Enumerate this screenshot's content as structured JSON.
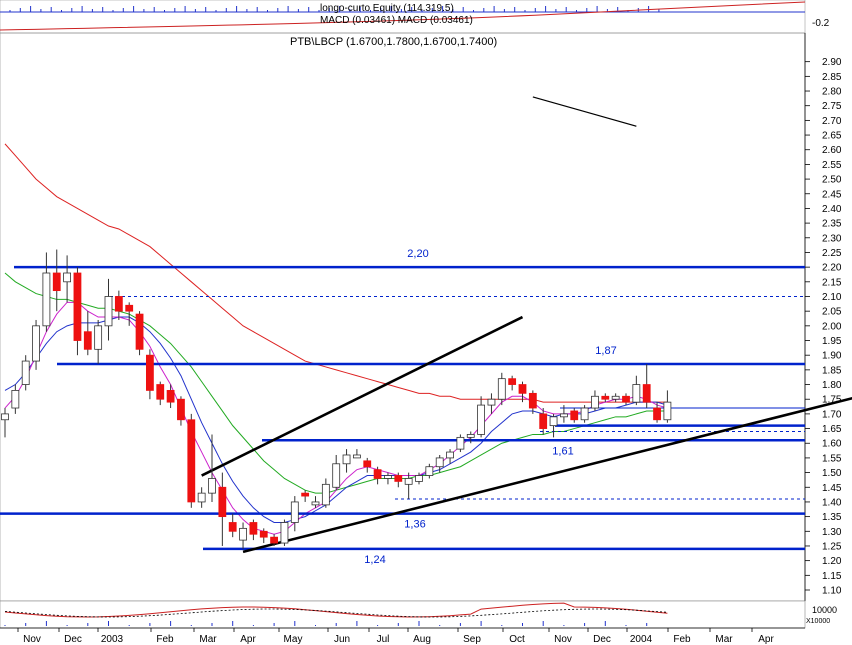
{
  "header": {
    "equity_label": "longo-curto Equity (114.319.5)",
    "macd_label": "MACD (0.03461) MACD (0.03461)",
    "macd_axis_tick": "-0.2"
  },
  "main_title": "PTB\\LBCP (1.6700,1.7800,1.6700,1.7400)",
  "bottom_axis_label": "10000",
  "bottom_axis_sub": "X10000",
  "colors": {
    "up": "#ffffff",
    "down": "#ee1111",
    "level": "#0022cc",
    "channel": "#000000",
    "ma_red": "#dd2222",
    "ma_green": "#22aa22",
    "ma_blue": "#2233cc",
    "ma_magenta": "#cc22cc"
  },
  "chart_data": {
    "type": "candlestick",
    "title": "PTB\\LBCP (1.6700,1.7800,1.6700,1.7400)",
    "ylim": [
      1.1,
      2.95
    ],
    "y_ticks": [
      "1.10",
      "1.15",
      "1.20",
      "1.25",
      "1.30",
      "1.35",
      "1.40",
      "1.45",
      "1.50",
      "1.55",
      "1.60",
      "1.65",
      "1.70",
      "1.75",
      "1.80",
      "1.85",
      "1.90",
      "1.95",
      "2.00",
      "2.05",
      "2.10",
      "2.15",
      "2.20",
      "2.25",
      "2.30",
      "2.35",
      "2.40",
      "2.45",
      "2.50",
      "2.55",
      "2.60",
      "2.65",
      "2.70",
      "2.75",
      "2.80",
      "2.85",
      "2.90"
    ],
    "x_ticks": [
      "Nov",
      "Dec",
      "2003",
      "Feb",
      "Mar",
      "Apr",
      "May",
      "Jun",
      "Jul",
      "Aug",
      "Sep",
      "Oct",
      "Nov",
      "Dec",
      "2004",
      "Feb",
      "Mar",
      "Apr"
    ],
    "candles": [
      {
        "o": 1.68,
        "h": 1.72,
        "l": 1.62,
        "c": 1.7
      },
      {
        "o": 1.72,
        "h": 1.8,
        "l": 1.7,
        "c": 1.78
      },
      {
        "o": 1.8,
        "h": 1.9,
        "l": 1.78,
        "c": 1.88
      },
      {
        "o": 1.88,
        "h": 2.02,
        "l": 1.85,
        "c": 2.0
      },
      {
        "o": 2.0,
        "h": 2.25,
        "l": 1.98,
        "c": 2.18
      },
      {
        "o": 2.18,
        "h": 2.26,
        "l": 2.05,
        "c": 2.12
      },
      {
        "o": 2.15,
        "h": 2.24,
        "l": 2.08,
        "c": 2.18
      },
      {
        "o": 2.18,
        "h": 2.2,
        "l": 1.9,
        "c": 1.95
      },
      {
        "o": 1.98,
        "h": 2.05,
        "l": 1.9,
        "c": 1.92
      },
      {
        "o": 1.92,
        "h": 2.02,
        "l": 1.87,
        "c": 2.0
      },
      {
        "o": 2.0,
        "h": 2.16,
        "l": 1.95,
        "c": 2.1
      },
      {
        "o": 2.1,
        "h": 2.12,
        "l": 2.02,
        "c": 2.05
      },
      {
        "o": 2.07,
        "h": 2.08,
        "l": 2.0,
        "c": 2.05
      },
      {
        "o": 2.04,
        "h": 2.05,
        "l": 1.9,
        "c": 1.92
      },
      {
        "o": 1.9,
        "h": 1.92,
        "l": 1.75,
        "c": 1.78
      },
      {
        "o": 1.8,
        "h": 1.81,
        "l": 1.73,
        "c": 1.75
      },
      {
        "o": 1.78,
        "h": 1.8,
        "l": 1.72,
        "c": 1.74
      },
      {
        "o": 1.75,
        "h": 1.76,
        "l": 1.66,
        "c": 1.68
      },
      {
        "o": 1.68,
        "h": 1.7,
        "l": 1.38,
        "c": 1.4
      },
      {
        "o": 1.4,
        "h": 1.45,
        "l": 1.38,
        "c": 1.43
      },
      {
        "o": 1.43,
        "h": 1.63,
        "l": 1.4,
        "c": 1.48
      },
      {
        "o": 1.45,
        "h": 1.5,
        "l": 1.25,
        "c": 1.35
      },
      {
        "o": 1.33,
        "h": 1.36,
        "l": 1.28,
        "c": 1.3
      },
      {
        "o": 1.27,
        "h": 1.33,
        "l": 1.24,
        "c": 1.31
      },
      {
        "o": 1.33,
        "h": 1.34,
        "l": 1.27,
        "c": 1.29
      },
      {
        "o": 1.3,
        "h": 1.31,
        "l": 1.26,
        "c": 1.28
      },
      {
        "o": 1.28,
        "h": 1.29,
        "l": 1.25,
        "c": 1.26
      },
      {
        "o": 1.26,
        "h": 1.34,
        "l": 1.25,
        "c": 1.33
      },
      {
        "o": 1.33,
        "h": 1.42,
        "l": 1.3,
        "c": 1.4
      },
      {
        "o": 1.43,
        "h": 1.44,
        "l": 1.4,
        "c": 1.42
      },
      {
        "o": 1.39,
        "h": 1.42,
        "l": 1.38,
        "c": 1.4
      },
      {
        "o": 1.39,
        "h": 1.48,
        "l": 1.38,
        "c": 1.46
      },
      {
        "o": 1.45,
        "h": 1.56,
        "l": 1.44,
        "c": 1.53
      },
      {
        "o": 1.53,
        "h": 1.58,
        "l": 1.5,
        "c": 1.56
      },
      {
        "o": 1.55,
        "h": 1.58,
        "l": 1.55,
        "c": 1.56
      },
      {
        "o": 1.54,
        "h": 1.55,
        "l": 1.5,
        "c": 1.52
      },
      {
        "o": 1.51,
        "h": 1.52,
        "l": 1.46,
        "c": 1.48
      },
      {
        "o": 1.48,
        "h": 1.5,
        "l": 1.46,
        "c": 1.49
      },
      {
        "o": 1.49,
        "h": 1.5,
        "l": 1.45,
        "c": 1.47
      },
      {
        "o": 1.46,
        "h": 1.5,
        "l": 1.41,
        "c": 1.48
      },
      {
        "o": 1.47,
        "h": 1.5,
        "l": 1.46,
        "c": 1.49
      },
      {
        "o": 1.49,
        "h": 1.53,
        "l": 1.48,
        "c": 1.52
      },
      {
        "o": 1.52,
        "h": 1.56,
        "l": 1.5,
        "c": 1.55
      },
      {
        "o": 1.55,
        "h": 1.58,
        "l": 1.53,
        "c": 1.57
      },
      {
        "o": 1.58,
        "h": 1.63,
        "l": 1.57,
        "c": 1.62
      },
      {
        "o": 1.62,
        "h": 1.64,
        "l": 1.6,
        "c": 1.63
      },
      {
        "o": 1.63,
        "h": 1.76,
        "l": 1.62,
        "c": 1.73
      },
      {
        "o": 1.73,
        "h": 1.77,
        "l": 1.7,
        "c": 1.75
      },
      {
        "o": 1.75,
        "h": 1.84,
        "l": 1.73,
        "c": 1.82
      },
      {
        "o": 1.82,
        "h": 1.83,
        "l": 1.78,
        "c": 1.8
      },
      {
        "o": 1.8,
        "h": 1.81,
        "l": 1.74,
        "c": 1.77
      },
      {
        "o": 1.77,
        "h": 1.78,
        "l": 1.7,
        "c": 1.72
      },
      {
        "o": 1.7,
        "h": 1.72,
        "l": 1.63,
        "c": 1.65
      },
      {
        "o": 1.66,
        "h": 1.7,
        "l": 1.62,
        "c": 1.69
      },
      {
        "o": 1.69,
        "h": 1.73,
        "l": 1.67,
        "c": 1.7
      },
      {
        "o": 1.71,
        "h": 1.72,
        "l": 1.67,
        "c": 1.68
      },
      {
        "o": 1.68,
        "h": 1.73,
        "l": 1.67,
        "c": 1.72
      },
      {
        "o": 1.72,
        "h": 1.78,
        "l": 1.71,
        "c": 1.76
      },
      {
        "o": 1.76,
        "h": 1.77,
        "l": 1.74,
        "c": 1.75
      },
      {
        "o": 1.75,
        "h": 1.77,
        "l": 1.74,
        "c": 1.76
      },
      {
        "o": 1.76,
        "h": 1.77,
        "l": 1.73,
        "c": 1.74
      },
      {
        "o": 1.74,
        "h": 1.83,
        "l": 1.73,
        "c": 1.8
      },
      {
        "o": 1.8,
        "h": 1.87,
        "l": 1.72,
        "c": 1.74
      },
      {
        "o": 1.72,
        "h": 1.74,
        "l": 1.67,
        "c": 1.68
      },
      {
        "o": 1.68,
        "h": 1.78,
        "l": 1.67,
        "c": 1.74
      }
    ],
    "levels": [
      {
        "value": 2.2,
        "label": "2,20",
        "style": "solid"
      },
      {
        "value": 1.87,
        "label": "1,87",
        "style": "solid"
      },
      {
        "value": 1.61,
        "label": "1,61",
        "style": "solid"
      },
      {
        "value": 1.36,
        "label": "1,36",
        "style": "solid"
      },
      {
        "value": 1.24,
        "label": "1,24",
        "style": "solid"
      },
      {
        "value": 1.66,
        "label": "",
        "style": "solid"
      },
      {
        "value": 1.72,
        "label": "",
        "style": "thin"
      },
      {
        "value": 2.1,
        "label": "",
        "style": "dashed"
      },
      {
        "value": 1.41,
        "label": "",
        "style": "dashed"
      },
      {
        "value": 1.64,
        "label": "",
        "style": "dashed"
      }
    ],
    "channel_lines": [
      {
        "from": [
          23,
          1.23
        ],
        "to": [
          104,
          1.95
        ]
      },
      {
        "from": [
          19,
          1.49
        ],
        "to": [
          50,
          2.03
        ]
      }
    ],
    "ma_red": [
      2.62,
      2.58,
      2.54,
      2.5,
      2.47,
      2.44,
      2.42,
      2.4,
      2.38,
      2.36,
      2.34,
      2.33,
      2.31,
      2.29,
      2.27,
      2.24,
      2.21,
      2.18,
      2.15,
      2.12,
      2.09,
      2.06,
      2.03,
      2.0,
      1.98,
      1.96,
      1.94,
      1.92,
      1.9,
      1.88,
      1.87,
      1.86,
      1.85,
      1.84,
      1.83,
      1.82,
      1.81,
      1.8,
      1.79,
      1.78,
      1.77,
      1.77,
      1.76,
      1.76,
      1.75,
      1.75,
      1.75,
      1.75,
      1.75,
      1.75,
      1.75,
      1.75,
      1.74,
      1.74,
      1.74,
      1.74,
      1.74,
      1.74,
      1.74,
      1.74,
      1.74,
      1.74,
      1.74,
      1.74,
      1.74
    ],
    "ma_green": [
      2.18,
      2.15,
      2.13,
      2.11,
      2.1,
      2.09,
      2.09,
      2.08,
      2.07,
      2.06,
      2.06,
      2.05,
      2.04,
      2.02,
      2.0,
      1.97,
      1.94,
      1.9,
      1.86,
      1.81,
      1.76,
      1.71,
      1.66,
      1.62,
      1.58,
      1.54,
      1.51,
      1.48,
      1.46,
      1.44,
      1.43,
      1.43,
      1.44,
      1.45,
      1.46,
      1.47,
      1.48,
      1.48,
      1.48,
      1.48,
      1.49,
      1.49,
      1.5,
      1.51,
      1.52,
      1.54,
      1.56,
      1.58,
      1.6,
      1.61,
      1.62,
      1.63,
      1.63,
      1.64,
      1.64,
      1.65,
      1.66,
      1.67,
      1.68,
      1.69,
      1.69,
      1.7,
      1.71,
      1.71,
      1.71
    ],
    "ma_blue": [
      1.78,
      1.8,
      1.84,
      1.89,
      1.94,
      1.98,
      2.0,
      2.01,
      2.01,
      2.01,
      2.02,
      2.03,
      2.03,
      2.01,
      1.98,
      1.94,
      1.89,
      1.83,
      1.75,
      1.67,
      1.6,
      1.53,
      1.47,
      1.42,
      1.38,
      1.35,
      1.33,
      1.33,
      1.34,
      1.35,
      1.37,
      1.39,
      1.42,
      1.45,
      1.47,
      1.49,
      1.49,
      1.49,
      1.49,
      1.49,
      1.49,
      1.5,
      1.51,
      1.53,
      1.55,
      1.57,
      1.6,
      1.64,
      1.67,
      1.7,
      1.71,
      1.71,
      1.7,
      1.69,
      1.7,
      1.7,
      1.7,
      1.71,
      1.72,
      1.72,
      1.73,
      1.74,
      1.74,
      1.74,
      1.73
    ],
    "ma_magenta": [
      1.72,
      1.76,
      1.82,
      1.9,
      1.98,
      2.04,
      2.08,
      2.08,
      2.05,
      2.03,
      2.03,
      2.03,
      2.02,
      1.98,
      1.93,
      1.86,
      1.8,
      1.72,
      1.64,
      1.57,
      1.5,
      1.44,
      1.38,
      1.34,
      1.31,
      1.3,
      1.29,
      1.3,
      1.33,
      1.36,
      1.38,
      1.4,
      1.44,
      1.48,
      1.51,
      1.52,
      1.51,
      1.5,
      1.49,
      1.49,
      1.49,
      1.51,
      1.53,
      1.56,
      1.59,
      1.62,
      1.66,
      1.7,
      1.74,
      1.76,
      1.76,
      1.74,
      1.71,
      1.7,
      1.7,
      1.7,
      1.71,
      1.73,
      1.74,
      1.75,
      1.75,
      1.76,
      1.75,
      1.73,
      1.72
    ],
    "upper_trend_line": [
      [
        51,
        2.78
      ],
      [
        56,
        2.73
      ],
      [
        61,
        2.68
      ]
    ]
  }
}
